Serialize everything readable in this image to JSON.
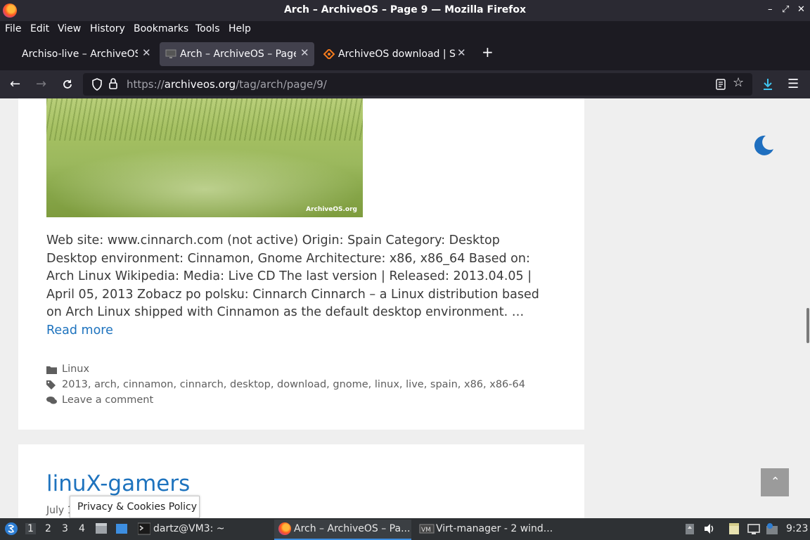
{
  "window": {
    "title": "Arch – ArchiveOS – Page 9 — Mozilla Firefox",
    "controls": [
      "–",
      "⤢",
      "✕"
    ]
  },
  "menubar": {
    "items": [
      "File",
      "Edit",
      "View",
      "History",
      "Bookmarks",
      "Tools",
      "Help"
    ]
  },
  "tabs": [
    {
      "label": "Archiso-live – ArchiveOS",
      "active": false
    },
    {
      "label": "Arch – ArchiveOS – Page",
      "active": true
    },
    {
      "label": "ArchiveOS download | So",
      "active": false
    }
  ],
  "toolbar": {
    "url_domain": "archiveos.org",
    "url_prefix": "https://",
    "url_path": "/tag/arch/page/9/",
    "accent_color": "#1e73be"
  },
  "page": {
    "hero_watermark": "ArchiveOS.org",
    "excerpt": "Web site: www.cinnarch.com (not active) Origin: Spain Category: Desktop Desktop environment: Cinnamon, Gnome Architecture: x86, x86_64 Based on: Arch Linux Wikipedia: Media: Live CD The last version | Released: 2013.04.05 | April 05, 2013 Zobacz po polsku: Cinnarch Cinnarch – a Linux distribution based on Arch Linux shipped with Cinnamon as the default desktop environment. …",
    "read_more": "Read more",
    "category": "Linux",
    "tags": "2013, arch, cinnamon, cinnarch, desktop, download, gnome, linux, live, spain, x86, x86-64",
    "comment": "Leave a comment",
    "next_post_title": "linuX-gamers",
    "next_post_date": "July 1",
    "cookie_label": "Privacy & Cookies Policy",
    "scroll_top_glyph": "⌃"
  },
  "taskbar": {
    "workspaces": [
      "1",
      "2",
      "3",
      "4"
    ],
    "terminal_label": "dartz@VM3: ~",
    "firefox_label": "Arch – ArchiveOS – Pa...",
    "virt_label": "Virt-manager - 2 wind...",
    "clock": "9:23"
  }
}
